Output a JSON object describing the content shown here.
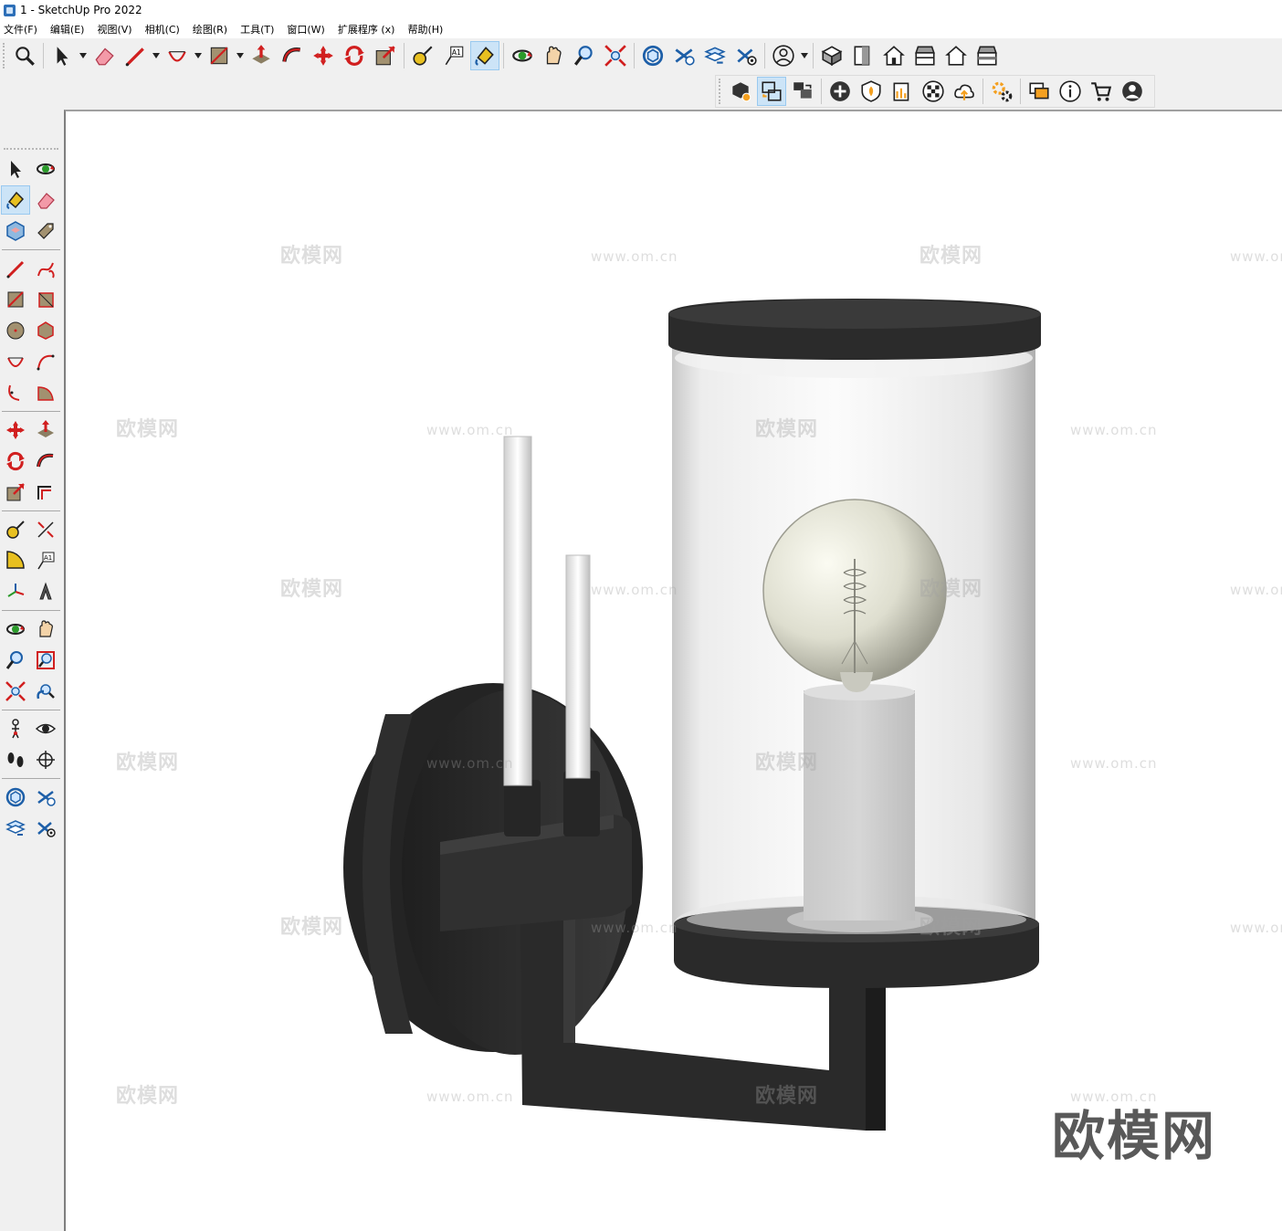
{
  "window": {
    "title": "1 - SketchUp Pro 2022"
  },
  "menu": [
    "文件(F)",
    "编辑(E)",
    "视图(V)",
    "相机(C)",
    "绘图(R)",
    "工具(T)",
    "窗口(W)",
    "扩展程序 (x)",
    "帮助(H)"
  ],
  "toolbar_row1": [
    {
      "icon": "zoom-icon"
    },
    "sep",
    {
      "icon": "select-arrow-icon",
      "dropdown": true
    },
    {
      "icon": "eraser-icon"
    },
    {
      "icon": "pencil-line-icon",
      "dropdown": true
    },
    {
      "icon": "arc-icon",
      "dropdown": true
    },
    {
      "icon": "rectangle-icon",
      "dropdown": true
    },
    {
      "icon": "push-pull-icon"
    },
    {
      "icon": "follow-me-icon"
    },
    {
      "icon": "move-icon"
    },
    {
      "icon": "rotate-icon"
    },
    {
      "icon": "scale-icon"
    },
    "sep",
    {
      "icon": "tape-measure-icon"
    },
    {
      "icon": "text-label-icon"
    },
    {
      "icon": "paint-bucket-icon",
      "active": true
    },
    "sep",
    {
      "icon": "orbit-icon"
    },
    {
      "icon": "pan-hand-icon"
    },
    {
      "icon": "zoom-glass-icon"
    },
    {
      "icon": "zoom-extents-icon"
    },
    "sep",
    {
      "icon": "3d-warehouse-icon"
    },
    {
      "icon": "extension-warehouse-icon"
    },
    {
      "icon": "layout-send-icon"
    },
    {
      "icon": "extension-manager-icon"
    },
    "sep",
    {
      "icon": "user-account-icon",
      "dropdown": true
    },
    "sep",
    {
      "icon": "iso-view-icon"
    },
    {
      "icon": "top-view-icon"
    },
    {
      "icon": "front-view-icon"
    },
    {
      "icon": "right-view-icon"
    },
    {
      "icon": "back-view-icon"
    },
    {
      "icon": "left-view-icon"
    }
  ],
  "toolbar_row2": [
    {
      "icon": "trimble-connect-icon"
    },
    {
      "icon": "section-swap-icon",
      "active": true
    },
    {
      "icon": "scenes-icon"
    },
    "sep",
    {
      "icon": "add-circle-icon"
    },
    {
      "icon": "shield-fire-icon"
    },
    {
      "icon": "report-chart-icon"
    },
    {
      "icon": "checker-icon"
    },
    {
      "icon": "cloud-upload-icon"
    },
    "sep",
    {
      "icon": "settings-gears-icon"
    },
    "sep",
    {
      "icon": "chat-bubble-icon"
    },
    {
      "icon": "info-icon"
    },
    {
      "icon": "cart-icon"
    },
    {
      "icon": "profile-icon"
    }
  ],
  "palette": [
    [
      "select-arrow-icon",
      "orbit-icon"
    ],
    [
      "paint-bucket-icon",
      "eraser-icon"
    ],
    [
      "component-icon",
      "tag-icon"
    ],
    "sep",
    [
      "pencil-line-icon",
      "freehand-icon"
    ],
    [
      "rectangle-icon",
      "rotated-rect-icon"
    ],
    [
      "circle-icon",
      "polygon-icon"
    ],
    [
      "arc-icon",
      "two-point-arc-icon"
    ],
    [
      "three-point-arc-icon",
      "pie-icon"
    ],
    "sep",
    [
      "move-icon",
      "push-pull-icon"
    ],
    [
      "rotate-icon",
      "follow-me-icon"
    ],
    [
      "scale-icon",
      "offset-icon"
    ],
    "sep",
    [
      "tape-measure-icon",
      "dimension-icon"
    ],
    [
      "protractor-icon",
      "text-label-icon"
    ],
    [
      "axes-icon",
      "3d-text-icon"
    ],
    "sep",
    [
      "orbit-icon",
      "pan-hand-icon"
    ],
    [
      "zoom-glass-icon",
      "zoom-window-icon"
    ],
    [
      "zoom-extents-icon",
      "previous-view-icon"
    ],
    "sep",
    [
      "position-camera-icon",
      "look-around-icon"
    ],
    [
      "walk-icon",
      "section-plane-icon"
    ],
    "sep",
    [
      "3d-warehouse-icon",
      "extension-warehouse-icon"
    ],
    [
      "layout-send-icon",
      "extension-manager-icon"
    ]
  ],
  "colors": {
    "ui_bg": "#f0f0f0",
    "viewport_bg": "#ffffff",
    "metal": "#2b2b2b",
    "glass": "#d8d8d8",
    "active_highlight": "#cce4f7"
  },
  "watermark": {
    "text": "欧模网",
    "url": "www.om.cn",
    "big_text": "欧模网"
  }
}
